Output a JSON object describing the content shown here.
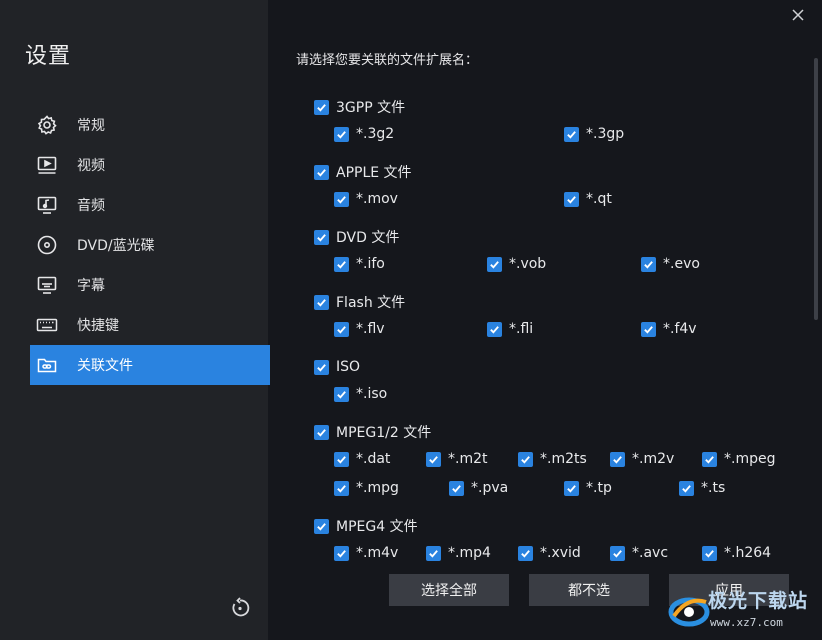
{
  "window": {
    "close_label": "×"
  },
  "sidebar": {
    "title": "设置",
    "items": [
      {
        "label": "常规",
        "icon": "gear-icon",
        "active": false
      },
      {
        "label": "视频",
        "icon": "video-icon",
        "active": false
      },
      {
        "label": "音频",
        "icon": "audio-icon",
        "active": false
      },
      {
        "label": "DVD/蓝光碟",
        "icon": "disc-icon",
        "active": false
      },
      {
        "label": "字幕",
        "icon": "subtitle-icon",
        "active": false
      },
      {
        "label": "快捷键",
        "icon": "keyboard-icon",
        "active": false
      },
      {
        "label": "关联文件",
        "icon": "folder-link-icon",
        "active": true
      }
    ],
    "reset_icon": "reset-icon"
  },
  "main": {
    "title": "请选择您要关联的文件扩展名：",
    "groups": [
      {
        "name": "3GPP 文件",
        "checked": true,
        "items": [
          {
            "ext": "*.3g2",
            "checked": true
          },
          {
            "ext": "*.3gp",
            "checked": true
          }
        ]
      },
      {
        "name": "APPLE 文件",
        "checked": true,
        "items": [
          {
            "ext": "*.mov",
            "checked": true
          },
          {
            "ext": "*.qt",
            "checked": true
          }
        ]
      },
      {
        "name": "DVD 文件",
        "checked": true,
        "items": [
          {
            "ext": "*.ifo",
            "checked": true
          },
          {
            "ext": "*.vob",
            "checked": true
          },
          {
            "ext": "*.evo",
            "checked": true
          }
        ]
      },
      {
        "name": "Flash 文件",
        "checked": true,
        "items": [
          {
            "ext": "*.flv",
            "checked": true
          },
          {
            "ext": "*.fli",
            "checked": true
          },
          {
            "ext": "*.f4v",
            "checked": true
          }
        ]
      },
      {
        "name": "ISO",
        "checked": true,
        "items": [
          {
            "ext": "*.iso",
            "checked": true
          }
        ]
      },
      {
        "name": "MPEG1/2 文件",
        "checked": true,
        "items": [
          {
            "ext": "*.dat",
            "checked": true
          },
          {
            "ext": "*.m2t",
            "checked": true
          },
          {
            "ext": "*.m2ts",
            "checked": true
          },
          {
            "ext": "*.m2v",
            "checked": true
          },
          {
            "ext": "*.mpeg",
            "checked": true
          },
          {
            "ext": "*.mpg",
            "checked": true
          },
          {
            "ext": "*.pva",
            "checked": true
          },
          {
            "ext": "*.tp",
            "checked": true
          },
          {
            "ext": "*.ts",
            "checked": true
          }
        ]
      },
      {
        "name": "MPEG4 文件",
        "checked": true,
        "items": [
          {
            "ext": "*.m4v",
            "checked": true
          },
          {
            "ext": "*.mp4",
            "checked": true
          },
          {
            "ext": "*.xvid",
            "checked": true
          },
          {
            "ext": "*.avc",
            "checked": true
          },
          {
            "ext": "*.h264",
            "checked": true
          }
        ]
      }
    ]
  },
  "buttons": {
    "select_all": "选择全部",
    "select_none": "都不选",
    "apply": "应用"
  },
  "watermark": {
    "title": "极光下载站",
    "url": "www.xz7.com"
  },
  "colors": {
    "accent": "#2a83e0",
    "sidebar_bg": "#212327",
    "main_bg": "#15171c",
    "button_bg": "#3a3d44"
  }
}
